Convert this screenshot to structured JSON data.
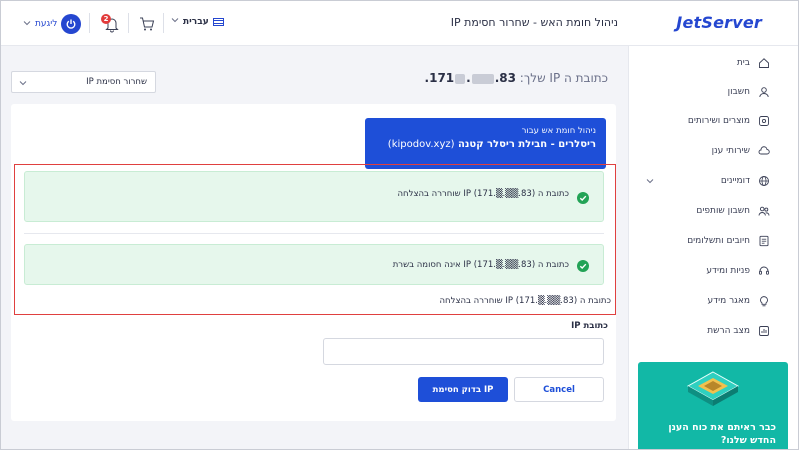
{
  "header": {
    "logo": "JetServer",
    "title": "ניהול חומת האש - שחרור חסימת IP",
    "logout_label": "ליגעת",
    "notification_count": "2",
    "language": "עברית"
  },
  "sidebar": {
    "items": [
      {
        "label": "בית",
        "icon": "home-icon"
      },
      {
        "label": "חשבון",
        "icon": "user-icon"
      },
      {
        "label": "מוצרים ושירותים",
        "icon": "products-icon"
      },
      {
        "label": "שירותי ענן",
        "icon": "cloud-icon"
      },
      {
        "label": "דומיינים",
        "icon": "globe-icon"
      },
      {
        "label": "חשבון שותפים",
        "icon": "partners-icon"
      },
      {
        "label": "חיובים ותשלומים",
        "icon": "billing-icon"
      },
      {
        "label": "פניות ומידע",
        "icon": "headset-icon"
      },
      {
        "label": "מאגר מידע",
        "icon": "lightbulb-icon"
      },
      {
        "label": "מצב הרשת",
        "icon": "network-status-icon"
      }
    ],
    "promo_text": "כבר ראיתם את כוח הענן החדש שלנו?"
  },
  "main": {
    "ip_heading_prefix": "כתובת ה IP שלך:",
    "ip_heading_start": "83.",
    "ip_heading_end": ".171",
    "select_value": "שחרור חסימת IP",
    "service_label": "ניהול חומת אש עבור",
    "service_name": "ריסלרים - חבילת ריסלר קטנה",
    "service_domain": "(kipodov.xyz)",
    "alert1": "כתובת ה IP (171.▒.▒▒.83) שוחררה בהצלחה",
    "alert2": "כתובת ה IP (171.▒.▒▒.83) אינה חסומה בשרת",
    "plain_message": "כתובת ה IP (171.▒.▒▒.83) שוחררה בהצלחה",
    "field_label": "כתובת IP",
    "input_value": "",
    "check_button": "בדוק חסימת IP",
    "cancel_button": "Cancel"
  },
  "colors": {
    "brand": "#2547d0",
    "primary_button": "#1e4fd8",
    "success_bg": "#e6f7ec",
    "success_icon": "#23a356",
    "highlight_frame": "#e0403f",
    "promo_bg": "#12b8a6"
  }
}
